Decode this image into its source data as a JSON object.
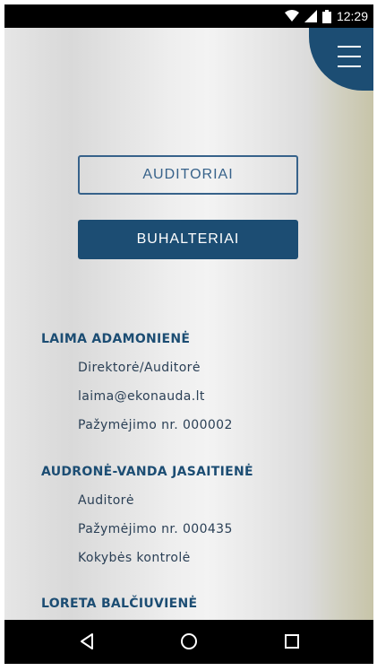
{
  "status_bar": {
    "time": "12:29"
  },
  "menu": {
    "icon": "hamburger-menu-icon",
    "color": "#1c4d73"
  },
  "buttons": {
    "auditors": "AUDITORIAI",
    "accountants": "BUHALTERIAI"
  },
  "people": [
    {
      "name": "LAIMA ADAMONIENĖ",
      "details": [
        "Direktorė/Auditorė",
        "laima@ekonauda.lt",
        "Pažymėjimo nr. 000002"
      ]
    },
    {
      "name": "AUDRONĖ-VANDA JASAITIENĖ",
      "details": [
        "Auditorė",
        "Pažymėjimo nr. 000435",
        "Kokybės kontrolė"
      ]
    },
    {
      "name": "LORETA BALČIUVIENĖ",
      "details": []
    }
  ],
  "nav_bar": {
    "back": "back-icon",
    "home": "home-icon",
    "recents": "recents-icon"
  }
}
